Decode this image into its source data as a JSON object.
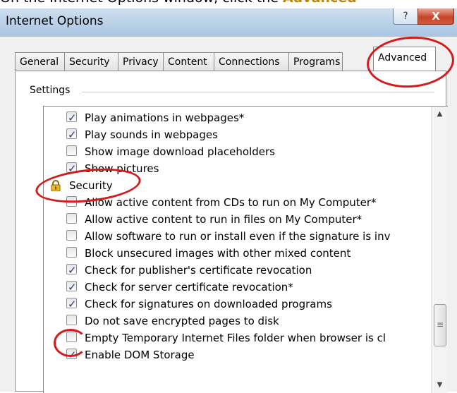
{
  "instruction": {
    "prefix": "On the Internet Options window, click the ",
    "emphasis": "Advanced"
  },
  "window": {
    "title": "Internet Options",
    "help_glyph": "?",
    "close_glyph": "X"
  },
  "tabs": [
    {
      "label": "General"
    },
    {
      "label": "Security"
    },
    {
      "label": "Privacy"
    },
    {
      "label": "Content"
    },
    {
      "label": "Connections"
    },
    {
      "label": "Programs"
    },
    {
      "label": "Advanced",
      "active": true
    }
  ],
  "settings": {
    "label": "Settings",
    "items": [
      {
        "label": "Play animations in webpages*",
        "checked": true
      },
      {
        "label": "Play sounds in webpages",
        "checked": true
      },
      {
        "label": "Show image download placeholders",
        "checked": false
      },
      {
        "label": "Show pictures",
        "checked": true
      },
      {
        "label": "Security",
        "group": true,
        "icon": "lock-icon"
      },
      {
        "label": "Allow active content from CDs to run on My Computer*",
        "checked": false
      },
      {
        "label": "Allow active content to run in files on My Computer*",
        "checked": false
      },
      {
        "label": "Allow software to run or install even if the signature is inv",
        "checked": false
      },
      {
        "label": "Block unsecured images with other mixed content",
        "checked": false
      },
      {
        "label": "Check for publisher's certificate revocation",
        "checked": true
      },
      {
        "label": "Check for server certificate revocation*",
        "checked": true
      },
      {
        "label": "Check for signatures on downloaded programs",
        "checked": true
      },
      {
        "label": "Do not save encrypted pages to disk",
        "checked": false
      },
      {
        "label": "Empty Temporary Internet Files folder when browser is cl",
        "checked": false
      },
      {
        "label": "Enable DOM Storage",
        "checked": true
      }
    ]
  },
  "scrollbar": {
    "up_glyph": "▲",
    "down_glyph": "▼",
    "thumb_glyph": "≡"
  },
  "colors": {
    "annotation": "#d41a1a",
    "checkmark": "#1f3e7a"
  }
}
